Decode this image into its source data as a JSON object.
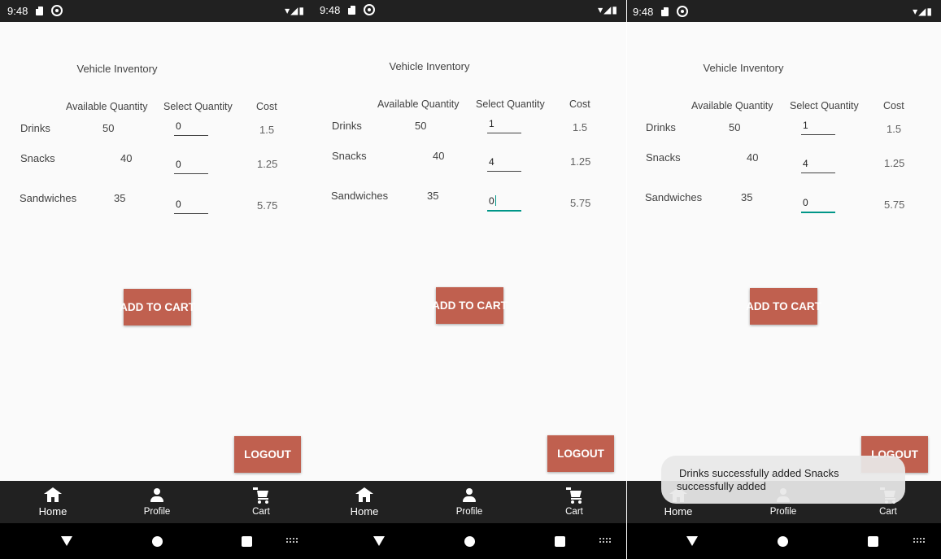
{
  "status": {
    "time": "9:48",
    "signal_icons": "▾◢▮"
  },
  "inventory": {
    "title": "Vehicle Inventory",
    "headers": {
      "available": "Available Quantity",
      "select": "Select Quantity",
      "cost": "Cost"
    },
    "items": [
      {
        "name": "Drinks",
        "available": "50",
        "cost": "1.5"
      },
      {
        "name": "Snacks",
        "available": "40",
        "cost": "1.25"
      },
      {
        "name": "Sandwiches",
        "available": "35",
        "cost": "5.75"
      }
    ]
  },
  "screens": [
    {
      "quantities": [
        "0",
        "0",
        "0"
      ],
      "focused_row": null
    },
    {
      "quantities": [
        "1",
        "4",
        "0"
      ],
      "focused_row": 2
    },
    {
      "quantities": [
        "1",
        "4",
        "0"
      ],
      "focused_row": 2
    }
  ],
  "buttons": {
    "add_to_cart": "ADD TO CART",
    "logout": "LOGOUT"
  },
  "bottom_nav": {
    "home": "Home",
    "profile": "Profile",
    "cart": "Cart",
    "active": "home"
  },
  "toast": {
    "line1": "Drinks successfully added  Snacks",
    "line2": "successfully added"
  },
  "colors": {
    "button": "#c0604f",
    "nav_bar": "#212121",
    "focus_underline": "#009688",
    "status_bar": "#212121"
  }
}
